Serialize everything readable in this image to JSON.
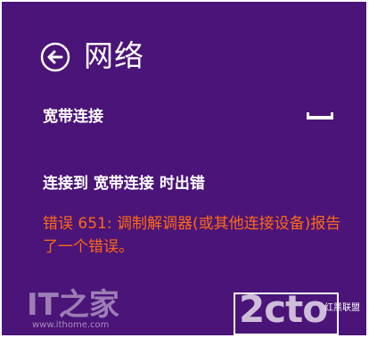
{
  "header": {
    "back_icon": "back-arrow-icon",
    "title": "网络"
  },
  "connection": {
    "name": "宽带连接",
    "icon": "ethernet-icon"
  },
  "error": {
    "heading": "连接到 宽带连接 时出错",
    "message": "错误 651: 调制解调器(或其他连接设备)报告了一个错误。"
  },
  "colors": {
    "background": "#4b1478",
    "error_text": "#ff6a13",
    "text": "#ffffff"
  },
  "watermark": {
    "logo": "IT之家",
    "url": "www.ithome.com",
    "stamp": "2cto",
    "stamp_sub": "红黑联盟"
  }
}
